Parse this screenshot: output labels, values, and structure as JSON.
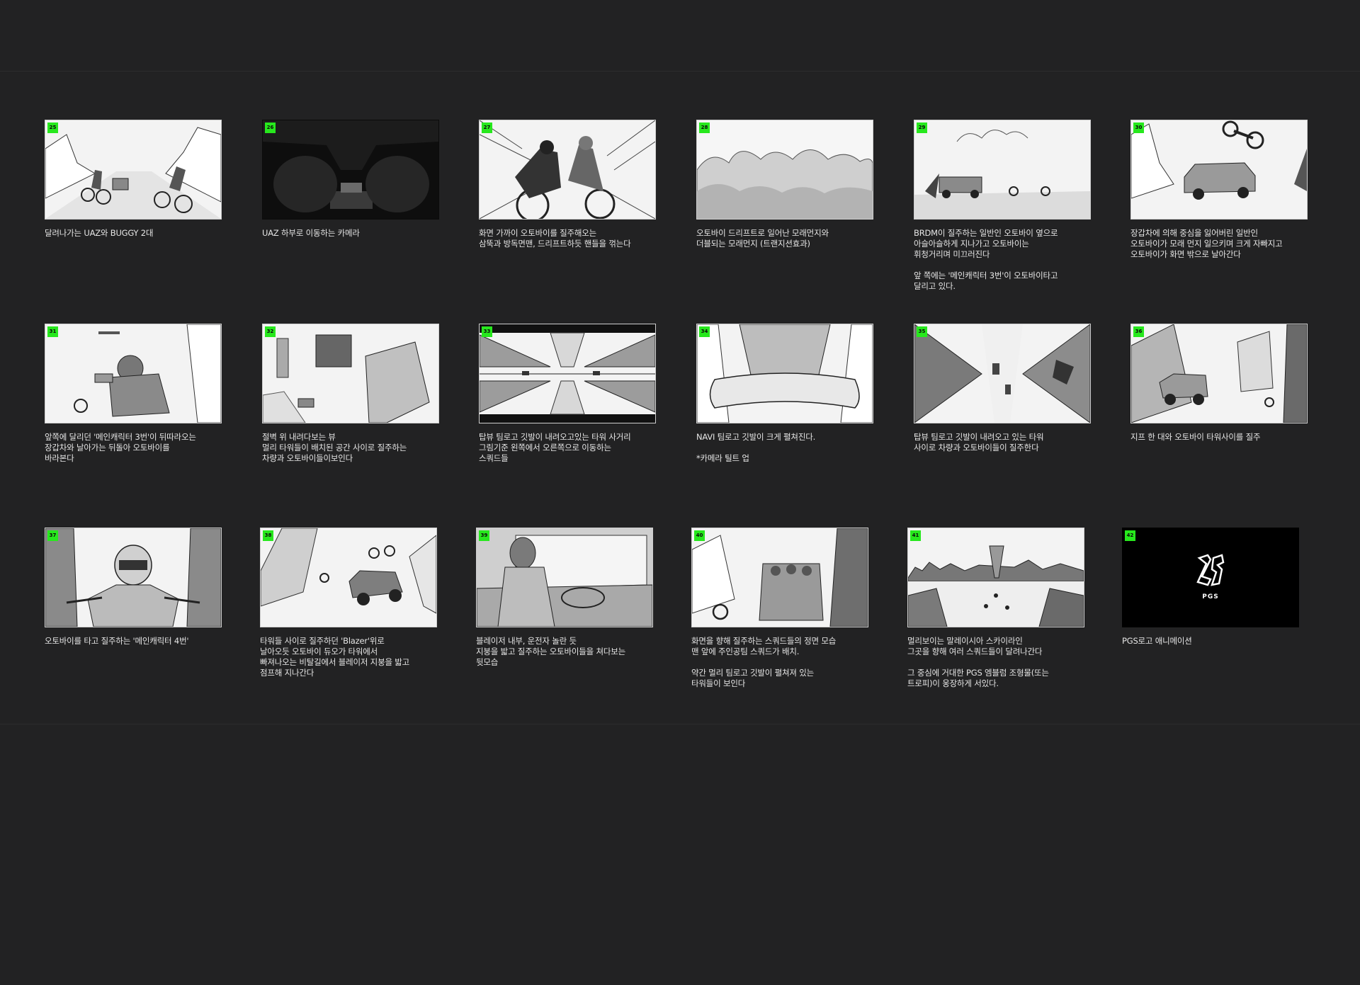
{
  "storyboard": {
    "panels": [
      {
        "number": "25",
        "caption": [
          "달려나가는 UAZ와 BUGGY 2대"
        ]
      },
      {
        "number": "26",
        "caption": [
          "UAZ 하부로 이동하는 카메라"
        ]
      },
      {
        "number": "27",
        "caption": [
          "화면 가까이 오토바이를 질주해오는",
          "삼뚝과 방독면맨, 드리프트하듯 핸들을 꺾는다"
        ]
      },
      {
        "number": "28",
        "caption": [
          "오토바이 드리프트로 일어난 모래먼지와",
          "더블되는 모래먼지 (트랜지션효과)"
        ]
      },
      {
        "number": "29",
        "caption": [
          "BRDM이 질주하는 일반인 오토바이 옆으로",
          "아슬아슬하게 지나가고 오토바이는",
          "휘청거리며 미끄러진다",
          "앞 쪽에는 '메인캐릭터 3번'이 오토바이타고",
          "달리고 있다."
        ]
      },
      {
        "number": "30",
        "caption": [
          "장갑차에 의해 중심을 잃어버린 일반인",
          "오토바이가 모래 먼지 일으키며 크게 자빠지고",
          "오토바이가 화면 밖으로 날아간다"
        ]
      },
      {
        "number": "31",
        "caption": [
          "앞쪽에 달리던 '메인캐릭터 3번'이 뒤따라오는",
          "장갑차와 날아가는 뒤돌아 오토바이를",
          "바라본다"
        ]
      },
      {
        "number": "32",
        "caption": [
          "절벽 위 내려다보는 뷰",
          "멀리 타워들이 배치된 공간 사이로 질주하는",
          "차량과 오토바이들이보인다"
        ]
      },
      {
        "number": "33",
        "caption": [
          "탑뷰 팀로고 깃발이 내려오고있는 타워 사거리",
          "그림기준 왼쪽에서 오른쪽으로 이동하는",
          "스쿼드들"
        ]
      },
      {
        "number": "34",
        "caption": [
          "NAVI 팀로고 깃발이 크게 펼쳐진다.",
          "*카메라 틸트 업"
        ]
      },
      {
        "number": "35",
        "caption": [
          "탑뷰 팀로고 깃발이 내려오고 있는 타워",
          "사이로 차량과 오토바이들이 질주한다"
        ]
      },
      {
        "number": "36",
        "caption": [
          "지프 한 대와 오토바이 타워사이를 질주"
        ]
      },
      {
        "number": "37",
        "caption": [
          "오토바이를 타고 질주하는 '메인캐릭터 4번'"
        ]
      },
      {
        "number": "38",
        "caption": [
          "타워들 사이로 질주하던 'Blazer'위로",
          "날아오듯 오토바이 듀오가 타워에서",
          "빠져나오는 비탈길에서 블레이저 지붕을 밟고",
          "점프해 지나간다"
        ]
      },
      {
        "number": "39",
        "caption": [
          "블레이저 내부, 운전자 놀란 듯",
          "지붕을 밟고 질주하는 오토바이들을 쳐다보는",
          "뒷모습"
        ]
      },
      {
        "number": "40",
        "caption": [
          "화면을 향해 질주하는 스쿼드들의 정면 모습",
          "맨 앞에 주인공팀 스쿼드가 배치.",
          "약간 멀리 팀로고 깃발이 펼쳐져 있는",
          "타워들이 보인다"
        ]
      },
      {
        "number": "41",
        "caption": [
          "멀리보이는 말레이시아 스카이라인",
          "그곳을 향해 여러 스쿼드들이 달려나간다",
          "그 중심에 거대한 PGS 엠블럼 조형물(또는",
          "트로피)이 웅장하게 서있다."
        ]
      },
      {
        "number": "42",
        "caption": [
          "PGS로고 애니메이션"
        ]
      }
    ],
    "logo_text": "PGS",
    "colors": {
      "background": "#222223",
      "tag": "#27e81d",
      "caption": "#e6e6e6"
    }
  }
}
